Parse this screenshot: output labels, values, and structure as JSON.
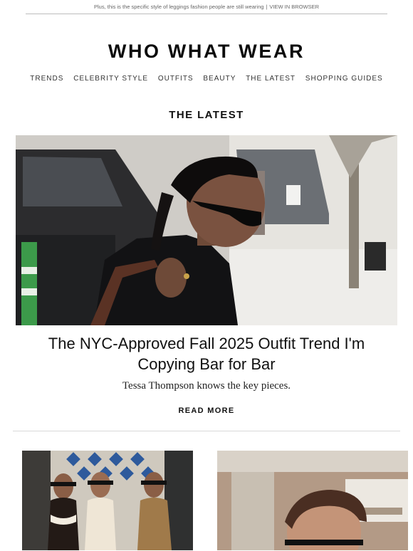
{
  "preheader": {
    "text": "Plus, this is the specific style of leggings fashion people are still wearing",
    "separator": "|",
    "link": "VIEW IN BROWSER"
  },
  "brand": {
    "logo": "WHO WHAT WEAR"
  },
  "nav": {
    "items": [
      "TRENDS",
      "CELEBRITY STYLE",
      "OUTFITS",
      "BEAUTY",
      "THE LATEST",
      "SHOPPING GUIDES"
    ]
  },
  "section": {
    "title": "THE LATEST"
  },
  "feature": {
    "image_icon": "photo-icon",
    "headline": "The NYC-Approved Fall 2025 Outfit Trend I'm Copying Bar for Bar",
    "dek": "Tessa Thompson knows the key pieces.",
    "cta": "READ MORE"
  },
  "colors": {
    "text": "#111111",
    "muted": "#666666",
    "rule": "#d9d9d9"
  }
}
